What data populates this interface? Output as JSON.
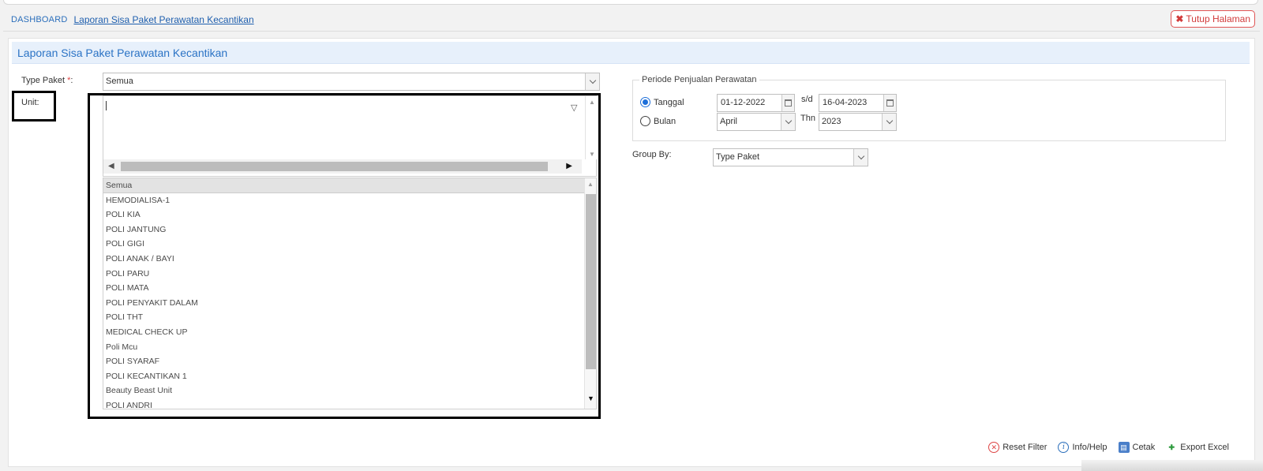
{
  "breadcrumb": {
    "home": "DASHBOARD",
    "current": "Laporan Sisa Paket Perawatan Kecantikan"
  },
  "close_button": {
    "label": "Tutup Halaman"
  },
  "panel": {
    "title": "Laporan Sisa Paket Perawatan Kecantikan"
  },
  "form": {
    "type_paket": {
      "label": "Type Paket",
      "required_mark": "*",
      "suffix": ":",
      "value": "Semua"
    },
    "unit": {
      "label": "Unit:",
      "input_value": "",
      "options": [
        "Semua",
        "HEMODIALISA-1",
        "POLI KIA",
        "POLI JANTUNG",
        "POLI GIGI",
        "POLI ANAK / BAYI",
        "POLI PARU",
        "POLI MATA",
        "POLI PENYAKIT DALAM",
        "POLI THT",
        "MEDICAL CHECK UP",
        "Poli Mcu",
        "POLI SYARAF",
        "POLI KECANTIKAN 1",
        "Beauty Beast Unit",
        "POLI ANDRI"
      ],
      "selected": "Semua"
    },
    "periode": {
      "legend": "Periode Penjualan Perawatan",
      "tanggal_label": "Tanggal",
      "bulan_label": "Bulan",
      "selected_mode": "Tanggal",
      "date_from": "01-12-2022",
      "sd_label": "s/d",
      "date_to": "16-04-2023",
      "month_value": "April",
      "thn_label": "Thn",
      "year_value": "2023"
    },
    "group_by": {
      "label": "Group By:",
      "value": "Type Paket"
    }
  },
  "actions": {
    "reset": "Reset Filter",
    "info": "Info/Help",
    "print": "Cetak",
    "excel": "Export Excel"
  }
}
